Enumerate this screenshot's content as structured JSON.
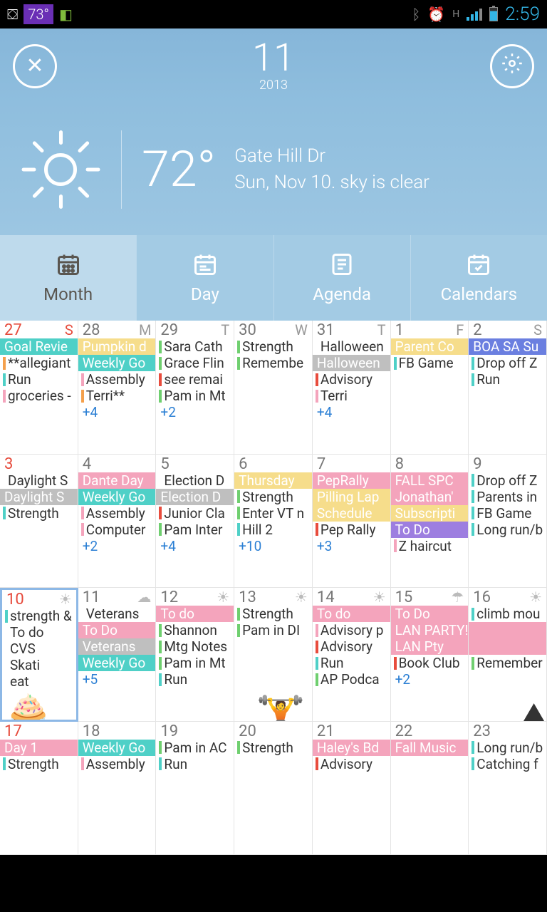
{
  "status": {
    "temp_widget": "73°",
    "clock": "2:59",
    "signal_label": "H"
  },
  "header": {
    "month": "11",
    "year": "2013"
  },
  "weather": {
    "temp": "72°",
    "location": "Gate Hill Dr",
    "summary": "Sun, Nov 10. sky is clear"
  },
  "tabs": {
    "month": "Month",
    "day": "Day",
    "agenda": "Agenda",
    "calendars": "Calendars",
    "active": "month"
  },
  "dow": [
    "S",
    "M",
    "T",
    "W",
    "T",
    "F",
    "S"
  ],
  "weeks": [
    [
      {
        "n": "27",
        "sun": true,
        "ev": [
          {
            "t": "Goal Revie",
            "fill": "teal"
          },
          {
            "t": "**allegiant",
            "bar": "orange"
          },
          {
            "t": "Run",
            "bar": "teal"
          },
          {
            "t": "groceries -",
            "bar": "pink"
          }
        ]
      },
      {
        "n": "28",
        "ev": [
          {
            "t": "Pumpkin d",
            "fill": "yellow"
          },
          {
            "t": "Weekly Go",
            "fill": "teal"
          },
          {
            "t": "Assembly",
            "bar": "pink"
          },
          {
            "t": "Terri**",
            "bar": "orange"
          }
        ],
        "more": "+4"
      },
      {
        "n": "29",
        "ev": [
          {
            "t": "Sara Cath",
            "bar": "green"
          },
          {
            "t": "Grace Flin",
            "bar": "green"
          },
          {
            "t": "see remai",
            "bar": "red"
          },
          {
            "t": "Pam in Mt",
            "bar": "green"
          }
        ],
        "more": "+2"
      },
      {
        "n": "30",
        "ev": [
          {
            "t": "Strength",
            "bar": "green"
          },
          {
            "t": "Remembe",
            "bar": "green"
          }
        ]
      },
      {
        "n": "31",
        "ev": [
          {
            "t": "Halloween",
            "bar": ""
          },
          {
            "t": "Halloween",
            "fill": "gray"
          },
          {
            "t": "Advisory",
            "bar": "red"
          },
          {
            "t": "Terri",
            "bar": "pink"
          }
        ],
        "more": "+4"
      },
      {
        "n": "1",
        "ev": [
          {
            "t": "Parent Co",
            "fill": "yellow"
          },
          {
            "t": "FB Game",
            "bar": "teal"
          }
        ]
      },
      {
        "n": "2",
        "ev": [
          {
            "t": "BOA SA Su",
            "fill": "blue"
          },
          {
            "t": "Drop off Z",
            "bar": "teal"
          },
          {
            "t": "Run",
            "bar": "teal"
          }
        ]
      }
    ],
    [
      {
        "n": "3",
        "sun": true,
        "ev": [
          {
            "t": "Daylight S",
            "bar": ""
          },
          {
            "t": "Daylight S",
            "fill": "gray"
          },
          {
            "t": "Strength",
            "bar": "teal"
          }
        ]
      },
      {
        "n": "4",
        "ev": [
          {
            "t": "Dante Day",
            "fill": "pink"
          },
          {
            "t": "Weekly Go",
            "fill": "teal"
          },
          {
            "t": "Assembly",
            "bar": "pink"
          },
          {
            "t": "Computer",
            "bar": "pink"
          }
        ],
        "more": "+2"
      },
      {
        "n": "5",
        "ev": [
          {
            "t": "Election D",
            "bar": ""
          },
          {
            "t": "Election D",
            "fill": "gray"
          },
          {
            "t": "Junior Cla",
            "bar": "red"
          },
          {
            "t": "Pam Inter",
            "bar": "green"
          }
        ],
        "more": "+4"
      },
      {
        "n": "6",
        "ev": [
          {
            "t": "Thursday",
            "fill": "yellow"
          },
          {
            "t": "Strength",
            "bar": "green"
          },
          {
            "t": "Enter VT n",
            "bar": "green"
          },
          {
            "t": "Hill 2",
            "bar": "teal"
          }
        ],
        "more": "+10"
      },
      {
        "n": "7",
        "ev": [
          {
            "t": "PepRally",
            "fill": "pink"
          },
          {
            "t": "Pilling Lap",
            "fill": "yellow"
          },
          {
            "t": "Schedule",
            "fill": "yellow"
          },
          {
            "t": "Pep Rally",
            "bar": "red"
          }
        ],
        "more": "+3"
      },
      {
        "n": "8",
        "ev": [
          {
            "t": "FALL SPC",
            "fill": "pink"
          },
          {
            "t": "Jonathan'",
            "fill": "pink"
          },
          {
            "t": "Subscripti",
            "fill": "yellow"
          },
          {
            "t": "To Do",
            "fill": "purple"
          },
          {
            "t": "Z haircut",
            "bar": "pink"
          }
        ]
      },
      {
        "n": "9",
        "ev": [
          {
            "t": "Drop off Z",
            "bar": "teal"
          },
          {
            "t": "Parents in",
            "bar": "teal"
          },
          {
            "t": "FB Game",
            "bar": "teal"
          },
          {
            "t": "Long run/b",
            "bar": "teal"
          }
        ]
      }
    ],
    [
      {
        "n": "10",
        "sun": true,
        "today": true,
        "wx": "sun",
        "ev": [
          {
            "t": "strength &",
            "bar": "teal"
          },
          {
            "t": "To do",
            "bar": ""
          },
          {
            "t": "CVS",
            "bar": ""
          },
          {
            "t": "Skati",
            "bar": ""
          },
          {
            "t": "eat",
            "bar": ""
          }
        ],
        "sticker": "cupcake"
      },
      {
        "n": "11",
        "wx": "cloud",
        "ev": [
          {
            "t": "Veterans",
            "bar": ""
          },
          {
            "t": "To Do",
            "fill": "pink"
          },
          {
            "t": "Veterans",
            "fill": "gray"
          },
          {
            "t": "Weekly Go",
            "fill": "teal"
          }
        ],
        "more": "+5"
      },
      {
        "n": "12",
        "wx": "sun",
        "ev": [
          {
            "t": "To do",
            "fill": "pink"
          },
          {
            "t": "Shannon",
            "bar": "green"
          },
          {
            "t": "Mtg Notes",
            "bar": "green"
          },
          {
            "t": "Pam in Mt",
            "bar": "green"
          },
          {
            "t": "Run",
            "bar": "teal"
          }
        ]
      },
      {
        "n": "13",
        "wx": "sun",
        "ev": [
          {
            "t": "Strength",
            "bar": "green"
          },
          {
            "t": "Pam in DI",
            "bar": "green"
          }
        ],
        "sticker": "dumbbell"
      },
      {
        "n": "14",
        "wx": "sun",
        "ev": [
          {
            "t": "To do",
            "fill": "pink"
          },
          {
            "t": "Advisory p",
            "bar": "pink"
          },
          {
            "t": "Advisory",
            "bar": "red"
          },
          {
            "t": "Run",
            "bar": "teal"
          },
          {
            "t": "AP Podca",
            "bar": "green"
          }
        ]
      },
      {
        "n": "15",
        "wx": "rain",
        "ev": [
          {
            "t": "To Do",
            "fill": "pink"
          },
          {
            "t": "LAN PARTY!",
            "fill": "pink"
          },
          {
            "t": "LAN Pty",
            "fill": "pink"
          },
          {
            "t": "Book Club",
            "bar": "red"
          }
        ],
        "more": "+2"
      },
      {
        "n": "16",
        "wx": "sun",
        "ev": [
          {
            "t": "climb mou",
            "bar": "teal"
          },
          {
            "t": "",
            "fill": "pink"
          },
          {
            "t": "",
            "fill": "pink"
          },
          {
            "t": "Remember",
            "bar": "green"
          }
        ],
        "sticker": "mountain"
      }
    ],
    [
      {
        "n": "17",
        "sun": true,
        "ev": [
          {
            "t": "Day 1",
            "fill": "pink"
          },
          {
            "t": "Strength",
            "bar": "teal"
          }
        ]
      },
      {
        "n": "18",
        "ev": [
          {
            "t": "Weekly Go",
            "fill": "teal"
          },
          {
            "t": "Assembly",
            "bar": "pink"
          }
        ]
      },
      {
        "n": "19",
        "ev": [
          {
            "t": "Pam in AC",
            "bar": "green"
          },
          {
            "t": "Run",
            "bar": "teal"
          }
        ]
      },
      {
        "n": "20",
        "ev": [
          {
            "t": "Strength",
            "bar": "green"
          }
        ]
      },
      {
        "n": "21",
        "ev": [
          {
            "t": "Haley's Bd",
            "fill": "pink"
          },
          {
            "t": "Advisory",
            "bar": "red"
          }
        ]
      },
      {
        "n": "22",
        "ev": [
          {
            "t": "Fall Music",
            "fill": "pink"
          }
        ]
      },
      {
        "n": "23",
        "ev": [
          {
            "t": "Long run/b",
            "bar": "teal"
          },
          {
            "t": "Catching f",
            "bar": "teal"
          }
        ]
      }
    ]
  ]
}
